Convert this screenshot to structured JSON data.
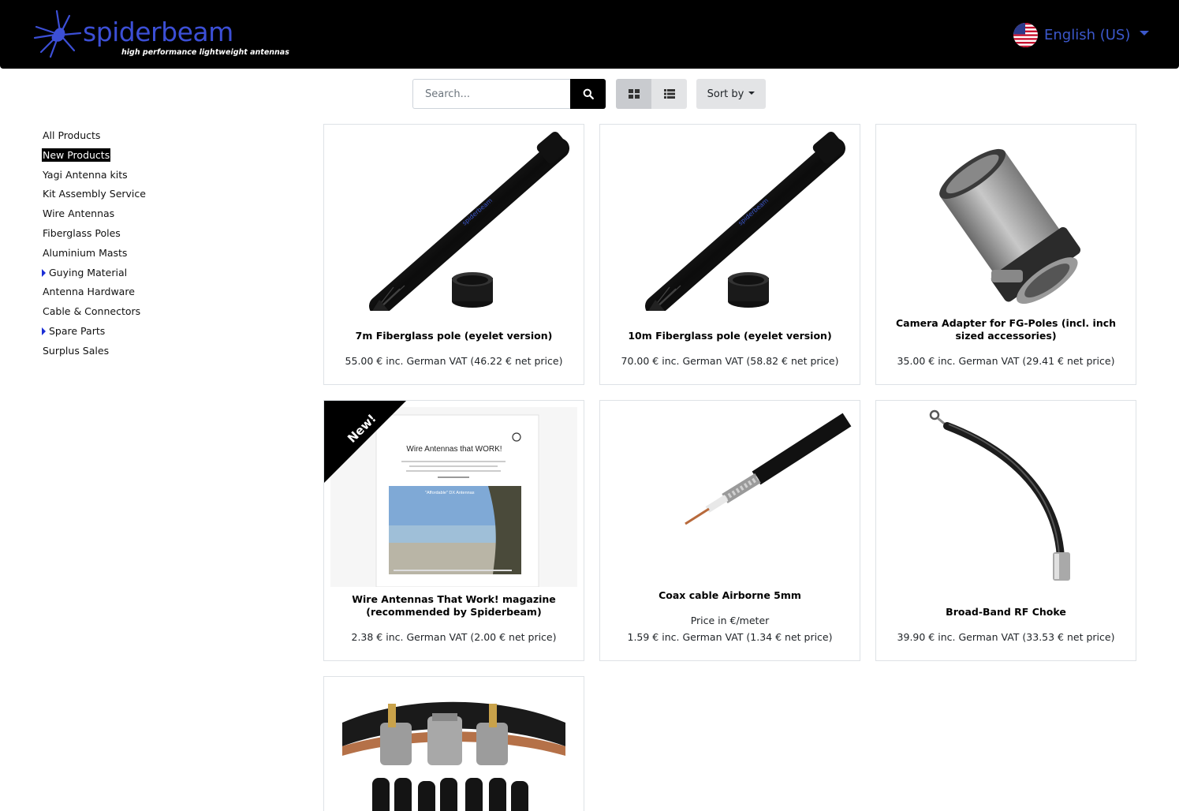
{
  "header": {
    "logo_word": "spiderbeam",
    "logo_tagline": "high performance lightweight antennas",
    "language": "English (US)"
  },
  "toolbar": {
    "search_placeholder": "Search...",
    "sort_label": "Sort by"
  },
  "sidebar": {
    "items": [
      {
        "label": "All Products"
      },
      {
        "label": "New Products",
        "active": true
      },
      {
        "label": "Yagi Antenna kits"
      },
      {
        "label": "Kit Assembly Service"
      },
      {
        "label": "Wire Antennas"
      },
      {
        "label": "Fiberglass Poles"
      },
      {
        "label": "Aluminium Masts"
      },
      {
        "label": "Guying Material",
        "expandable": true
      },
      {
        "label": "Antenna Hardware"
      },
      {
        "label": "Cable & Connectors"
      },
      {
        "label": "Spare Parts",
        "expandable": true
      },
      {
        "label": "Surplus Sales"
      }
    ]
  },
  "products": [
    {
      "name": "7m Fiberglass pole (eyelet version)",
      "price": "55.00 € inc. German VAT (46.22 € net price)"
    },
    {
      "name": "10m Fiberglass pole (eyelet version)",
      "price": "70.00 € inc. German VAT (58.82 € net price)"
    },
    {
      "name": "Camera Adapter for FG-Poles (incl. inch sized accessories)",
      "price": "35.00 € inc. German VAT (29.41 € net price)"
    },
    {
      "name": "Wire Antennas That Work! magazine (recommended by Spiderbeam)",
      "price": "2.38 € inc. German VAT (2.00 € net price)",
      "ribbon": "New!",
      "magazine_title": "Wire Antennas that WORK!",
      "magazine_caption": "\"Affordable\" DX Antennas"
    },
    {
      "name": "Coax cable Airborne 5mm",
      "subtitle": "Price in €/meter",
      "price": "1.59 € inc. German VAT (1.34 € net price)"
    },
    {
      "name": "Broad-Band RF Choke",
      "price": "39.90 € inc. German VAT (33.53 € net price)"
    },
    {
      "name": "",
      "price": ""
    }
  ],
  "colors": {
    "header_bg": "#000000",
    "brand_blue": "#3c4fd6",
    "active_category_bg": "#000000"
  },
  "icons": {
    "search": "search-icon",
    "grid": "grid-view-icon",
    "list": "list-view-icon",
    "flag": "us-flag-icon"
  }
}
